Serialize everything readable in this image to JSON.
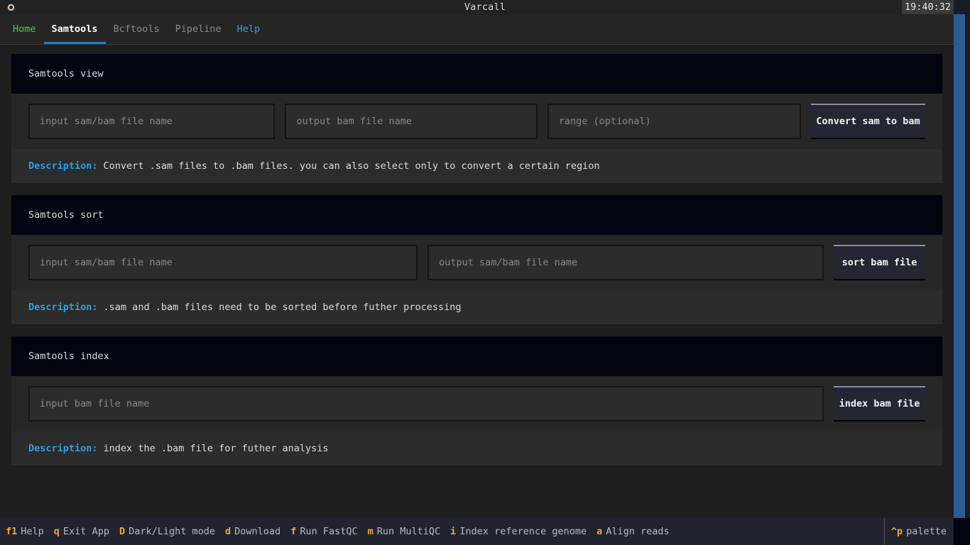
{
  "titlebar": {
    "logo_icon": "ring-icon",
    "title": "Varcall",
    "clock": "19:40:32"
  },
  "tabs": [
    {
      "label": "Home",
      "state": "home"
    },
    {
      "label": "Samtools",
      "state": "active"
    },
    {
      "label": "Bcftools",
      "state": "inactive"
    },
    {
      "label": "Pipeline",
      "state": "inactive"
    },
    {
      "label": "Help",
      "state": "help"
    }
  ],
  "panels": [
    {
      "title": "Samtools view",
      "inputs": [
        {
          "placeholder": "input sam/bam file name",
          "value": ""
        },
        {
          "placeholder": "output bam file name",
          "value": ""
        },
        {
          "placeholder": "range (optional)",
          "value": ""
        }
      ],
      "button": "Convert sam to bam",
      "desc_label": "Description:",
      "desc_text": "Convert .sam files to .bam files. you can also select only to convert a certain region"
    },
    {
      "title": "Samtools sort",
      "inputs": [
        {
          "placeholder": "input sam/bam file name",
          "value": ""
        },
        {
          "placeholder": "output sam/bam file name",
          "value": ""
        }
      ],
      "button": "sort bam file",
      "desc_label": "Description:",
      "desc_text": ".sam and .bam files need to be sorted before futher processing"
    },
    {
      "title": "Samtools index",
      "inputs": [
        {
          "placeholder": "input bam file name",
          "value": ""
        }
      ],
      "button": "index bam file",
      "desc_label": "Description:",
      "desc_text": "index the .bam file for futher analysis"
    }
  ],
  "footer": {
    "keys": [
      {
        "key": "f1",
        "text": "Help"
      },
      {
        "key": "q",
        "text": "Exit App"
      },
      {
        "key": "D",
        "text": "Dark/Light mode"
      },
      {
        "key": "d",
        "text": "Download"
      },
      {
        "key": "f",
        "text": "Run FastQC"
      },
      {
        "key": "m",
        "text": "Run MultiQC"
      },
      {
        "key": "i",
        "text": "Index reference genome"
      },
      {
        "key": "a",
        "text": "Align reads"
      }
    ],
    "palette_key": "^p",
    "palette_text": "palette"
  },
  "colors": {
    "accent_blue": "#1f7fd0",
    "cyan": "#2f9fe0",
    "green": "#3ecf48",
    "orange": "#f2a33c",
    "scrollbar": "#2a5d91",
    "panel_header_bg": "#03040f"
  }
}
